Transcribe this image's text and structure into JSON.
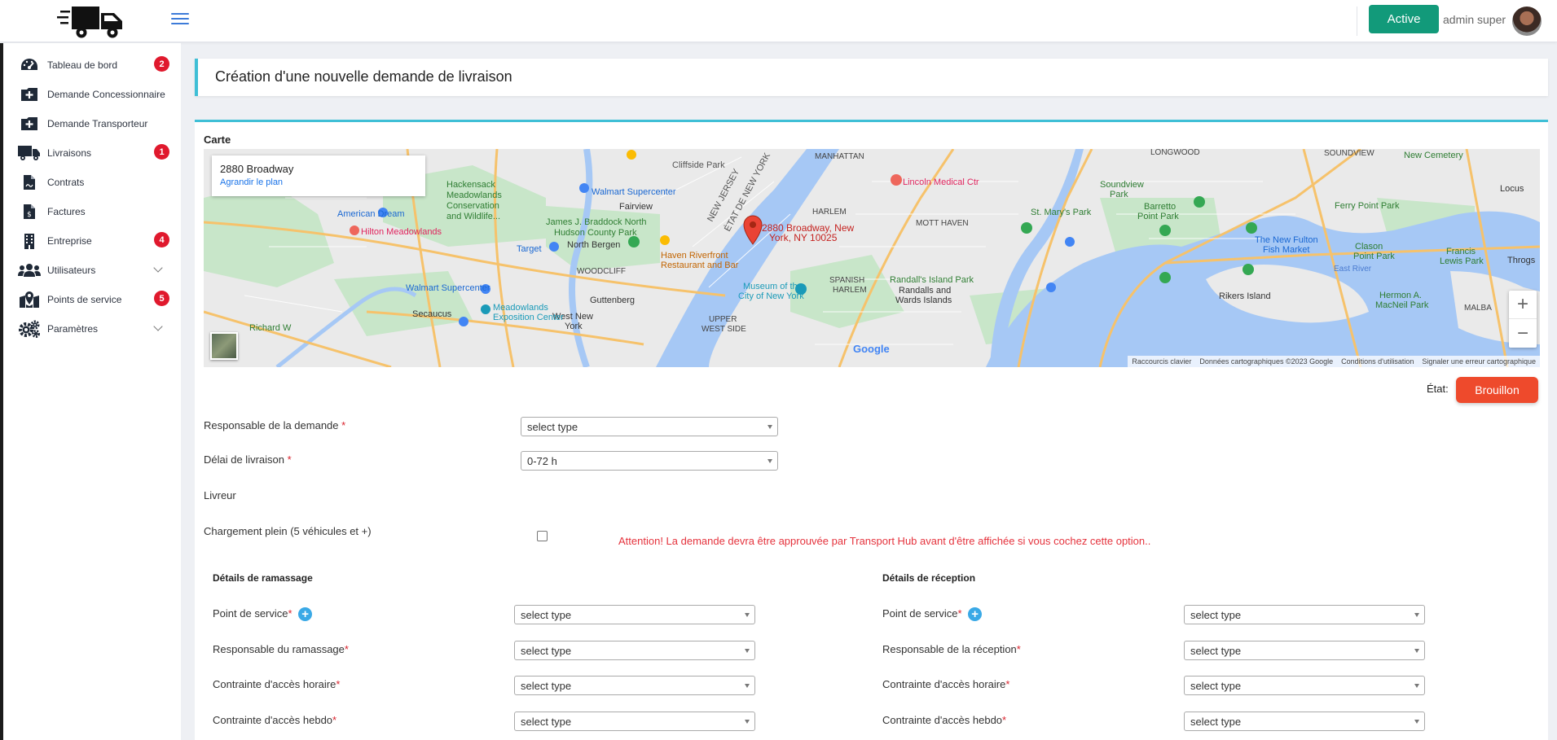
{
  "topbar": {
    "status_label": "Active",
    "user_name": "admin super"
  },
  "sidebar": {
    "items": [
      {
        "label": "Tableau de bord",
        "badge": "2"
      },
      {
        "label": "Demande Concessionnaire"
      },
      {
        "label": "Demande Transporteur"
      },
      {
        "label": "Livraisons",
        "badge": "1"
      },
      {
        "label": "Contrats"
      },
      {
        "label": "Factures"
      },
      {
        "label": "Entreprise",
        "badge": "4"
      },
      {
        "label": "Utilisateurs"
      },
      {
        "label": "Points de service",
        "badge": "5"
      },
      {
        "label": "Paramètres"
      }
    ]
  },
  "header": {
    "title": "Création d'une nouvelle demande de livraison"
  },
  "map": {
    "section_label": "Carte",
    "popup_title": "2880 Broadway",
    "popup_link": "Agrandir le plan",
    "marker_label_line1": "2880 Broadway, New",
    "marker_label_line2": "York, NY 10025",
    "places": {
      "cliffside": "Cliffside Park",
      "manhattan": "MANHATTAN",
      "longwood": "LONGWOOD",
      "soundview_caps": "SOUNDVIEW",
      "new_cemetery": "New Cemetery",
      "hackensack_line1": "Hackensack",
      "hackensack_line2": "Meadowlands",
      "hackensack_line3": "Conservation",
      "hackensack_line4": "and Wildlife...",
      "walmart1": "Walmart Supercenter",
      "fairview": "Fairview",
      "american_dream": "American Dream",
      "hilton": "Hilton Meadowlands",
      "braddock1": "James J. Braddock North",
      "braddock2": "Hudson County Park",
      "north_bergen": "North Bergen",
      "target": "Target",
      "woodcliff": "WOODCLIFF",
      "haven1": "Haven Riverfront",
      "haven2": "Restaurant and Bar",
      "nj": "NEW JERSEY",
      "ny": "ÉTAT DE NEW YORK",
      "harlem": "HARLEM",
      "lincoln": "Lincoln Medical Ctr",
      "mott": "MOTT HAVEN",
      "st_mary": "St. Mary's Park",
      "soundview_park1": "Soundview",
      "soundview_park2": "Park",
      "barretto1": "Barretto",
      "barretto2": "Point Park",
      "ferry": "Ferry Point Park",
      "locust": "Locus",
      "fulton1": "The New Fulton",
      "fulton2": "Fish Market",
      "clason1": "Clason",
      "clason2": "Point Park",
      "francis1": "Francis",
      "francis2": "Lewis Park",
      "throgs": "Throgs",
      "east_river": "East River",
      "rikers": "Rikers Island",
      "hermon1": "Hermon A.",
      "hermon2": "MacNeil Park",
      "malba": "MALBA",
      "walmart2": "Walmart Supercenter",
      "secaucus": "Secaucus",
      "guttenberg": "Guttenberg",
      "west_new1": "West New",
      "west_new2": "York",
      "meadowlands1": "Meadowlands",
      "meadowlands2": "Exposition Center",
      "museum1": "Museum of the",
      "museum2": "City of New York",
      "spanish1": "SPANISH",
      "spanish2": "HARLEM",
      "randalls1": "Randall's Island Park",
      "randalls2": "Randalls and",
      "randalls3": "Wards Islands",
      "upper_west": "UPPER",
      "upper_west2": "WEST SIDE",
      "richard": "Richard W",
      "google": "Google"
    },
    "zoom_in": "+",
    "zoom_out": "−",
    "footer": {
      "shortcuts": "Raccourcis clavier",
      "data": "Données cartographiques ©2023 Google",
      "terms": "Conditions d'utilisation",
      "report": "Signaler une erreur cartographique"
    }
  },
  "state": {
    "label": "État:",
    "value": "Brouillon"
  },
  "form": {
    "responsable_label": "Responsable de la demande",
    "responsable_value": "select type",
    "delai_label": "Délai de livraison",
    "delai_value": "0-72 h",
    "livreur_label": "Livreur",
    "chargement_label": "Chargement plein (5 véhicules et +)",
    "warning": "Attention! La demande devra être approuvée par Transport Hub avant d'être affichée si vous cochez cette option..",
    "required_mark": "*"
  },
  "pickup": {
    "title": "Détails de ramassage",
    "fields": [
      {
        "label": "Point de service",
        "value": "select type"
      },
      {
        "label": "Responsable du ramassage",
        "value": "select type"
      },
      {
        "label": "Contrainte d'accès horaire",
        "value": "select type"
      },
      {
        "label": "Contrainte d'accès hebdo",
        "value": "select type"
      }
    ]
  },
  "reception": {
    "title": "Détails de réception",
    "fields": [
      {
        "label": "Point de service",
        "value": "select type"
      },
      {
        "label": "Responsable de la réception",
        "value": "select type"
      },
      {
        "label": "Contrainte d'accès horaire",
        "value": "select type"
      },
      {
        "label": "Contrainte d'accès hebdo",
        "value": "select type"
      }
    ]
  },
  "colors": {
    "accent": "#3fbfd6",
    "active": "#129a7a",
    "draft": "#ee4a2c",
    "badge": "#e0192d",
    "warning": "#e5333d"
  }
}
